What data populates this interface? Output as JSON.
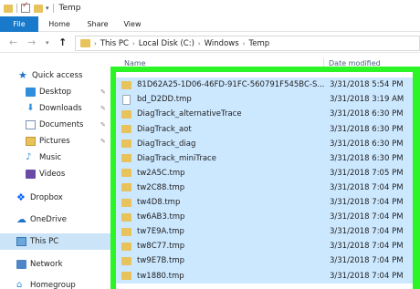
{
  "window": {
    "title": "Temp"
  },
  "ribbon": {
    "tabs": [
      "File",
      "Home",
      "Share",
      "View"
    ]
  },
  "address": {
    "crumbs": [
      "This PC",
      "Local Disk (C:)",
      "Windows",
      "Temp"
    ]
  },
  "sidebar": {
    "items": [
      {
        "label": "Quick access",
        "icon": "star-icon"
      },
      {
        "label": "Desktop",
        "icon": "desktop-icon"
      },
      {
        "label": "Downloads",
        "icon": "download-icon"
      },
      {
        "label": "Documents",
        "icon": "documents-icon"
      },
      {
        "label": "Pictures",
        "icon": "pictures-icon"
      },
      {
        "label": "Music",
        "icon": "music-icon"
      },
      {
        "label": "Videos",
        "icon": "videos-icon"
      },
      {
        "label": "Dropbox",
        "icon": "dropbox-icon"
      },
      {
        "label": "OneDrive",
        "icon": "onedrive-icon"
      },
      {
        "label": "This PC",
        "icon": "this-pc-icon"
      },
      {
        "label": "Network",
        "icon": "network-icon"
      },
      {
        "label": "Homegroup",
        "icon": "homegroup-icon"
      }
    ]
  },
  "list": {
    "columns": {
      "name": "Name",
      "date": "Date modified"
    },
    "files": [
      {
        "name": "81D62A25-1D06-46FD-91FC-560791F545BC-S...",
        "date": "3/31/2018 5:54 PM",
        "type": "folder"
      },
      {
        "name": "bd_D2DD.tmp",
        "date": "3/31/2018 3:19 AM",
        "type": "file"
      },
      {
        "name": "DiagTrack_alternativeTrace",
        "date": "3/31/2018 6:30 PM",
        "type": "folder"
      },
      {
        "name": "DiagTrack_aot",
        "date": "3/31/2018 6:30 PM",
        "type": "folder"
      },
      {
        "name": "DiagTrack_diag",
        "date": "3/31/2018 6:30 PM",
        "type": "folder"
      },
      {
        "name": "DiagTrack_miniTrace",
        "date": "3/31/2018 6:30 PM",
        "type": "folder"
      },
      {
        "name": "tw2A5C.tmp",
        "date": "3/31/2018 7:05 PM",
        "type": "folder"
      },
      {
        "name": "tw2C88.tmp",
        "date": "3/31/2018 7:04 PM",
        "type": "folder"
      },
      {
        "name": "tw4D8.tmp",
        "date": "3/31/2018 7:04 PM",
        "type": "folder"
      },
      {
        "name": "tw6AB3.tmp",
        "date": "3/31/2018 7:04 PM",
        "type": "folder"
      },
      {
        "name": "tw7E9A.tmp",
        "date": "3/31/2018 7:04 PM",
        "type": "folder"
      },
      {
        "name": "tw8C77.tmp",
        "date": "3/31/2018 7:04 PM",
        "type": "folder"
      },
      {
        "name": "tw9E7B.tmp",
        "date": "3/31/2018 7:04 PM",
        "type": "folder"
      },
      {
        "name": "tw1880.tmp",
        "date": "3/31/2018 7:04 PM",
        "type": "folder"
      }
    ]
  },
  "colors": {
    "accent": "#1979ca",
    "highlight": "#2bf525",
    "selection": "#cce8ff"
  }
}
